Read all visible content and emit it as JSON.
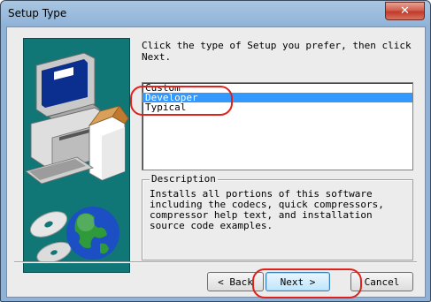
{
  "window": {
    "title": "Setup Type",
    "close_glyph": "✕"
  },
  "prompt": "Click the type of Setup you prefer, then click Next.",
  "setup_types": {
    "options": [
      "Custom",
      "Developer",
      "Typical"
    ],
    "selected": "Developer"
  },
  "description": {
    "legend": "Description",
    "text": "Installs all portions of this software including the codecs, quick compressors, compressor help text, and installation source code examples."
  },
  "buttons": {
    "back": "< Back",
    "next": "Next >",
    "cancel": "Cancel"
  },
  "colors": {
    "selection": "#3399ff",
    "art_background": "#117676",
    "annotation": "#e0201a",
    "close": "#c1392a"
  },
  "icons": [
    "close-icon",
    "computer-illustration",
    "cd-disc-icon",
    "globe-icon"
  ]
}
